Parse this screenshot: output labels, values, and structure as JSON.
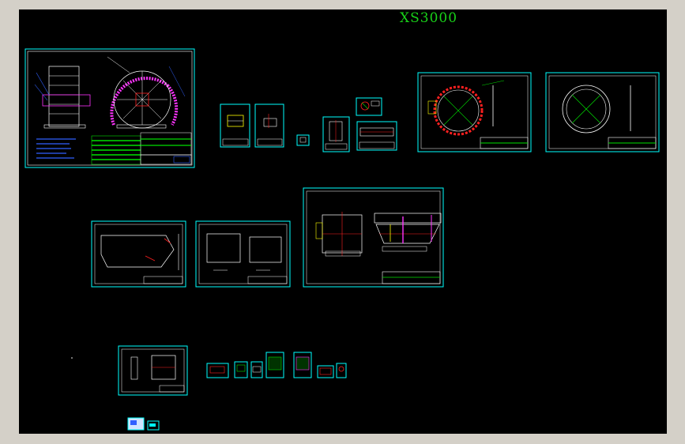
{
  "drawing": {
    "title": "XS3000"
  },
  "colors": {
    "ui_frame": "#d4d0c8",
    "model_space": "#000000",
    "sheet_border": "#00ffff",
    "title_text": "#19d219",
    "geometry_white": "#ffffff",
    "geometry_magenta": "#ff33ff",
    "geometry_red": "#ff2020",
    "geometry_green": "#00e000",
    "geometry_yellow": "#ffff00",
    "geometry_blue": "#3060ff"
  }
}
